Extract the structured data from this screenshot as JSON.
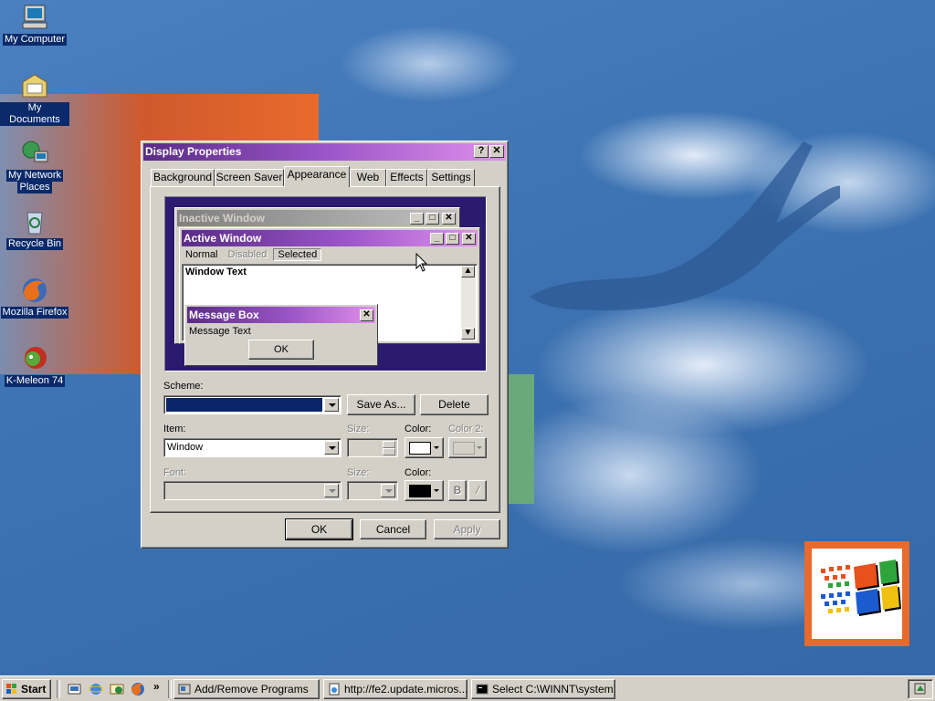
{
  "desktop": {
    "icons": [
      {
        "label": "My Computer",
        "icon": "my-computer-icon"
      },
      {
        "label": "My Documents",
        "icon": "my-documents-icon"
      },
      {
        "label": "My Network",
        "label2": "Places",
        "icon": "network-places-icon"
      },
      {
        "label": "Recycle Bin",
        "icon": "recycle-bin-icon"
      },
      {
        "label": "Mozilla Firefox",
        "icon": "firefox-icon"
      },
      {
        "label": "K-Meleon 74",
        "icon": "k-meleon-icon"
      }
    ]
  },
  "dialog": {
    "title": "Display Properties",
    "help": "?",
    "close": "✕",
    "tabs": [
      "Background",
      "Screen Saver",
      "Appearance",
      "Web",
      "Effects",
      "Settings"
    ],
    "active_tab": "Appearance",
    "preview": {
      "inactive_title": "Inactive Window",
      "active_title": "Active Window",
      "menu_normal": "Normal",
      "menu_disabled": "Disabled",
      "menu_selected": "Selected",
      "window_text": "Window Text",
      "msgbox_title": "Message Box",
      "msgbox_text": "Message Text",
      "msgbox_ok": "OK"
    },
    "scheme_label": "Scheme:",
    "scheme_value": "",
    "save_as": "Save As...",
    "delete": "Delete",
    "item_label": "Item:",
    "item_value": "Window",
    "size_label": "Size:",
    "color_label": "Color:",
    "color2_label": "Color 2:",
    "font_label": "Font:",
    "font_size_label": "Size:",
    "font_color_label": "Color:",
    "bold": "B",
    "italic": "/",
    "ok": "OK",
    "cancel": "Cancel",
    "apply": "Apply",
    "colors": {
      "item_color": "#ffffff",
      "font_color": "#000000",
      "scheme_fill": "#0a246a"
    }
  },
  "taskbar": {
    "start": "Start",
    "chevron": "»",
    "tasks": [
      {
        "label": "Add/Remove Programs",
        "icon": "add-remove-icon"
      },
      {
        "label": "http://fe2.update.micros...",
        "icon": "ie-page-icon"
      },
      {
        "label": "Select C:\\WINNT\\system...",
        "icon": "console-icon"
      }
    ],
    "quick_launch": [
      "show-desktop-icon",
      "ie-icon",
      "outlook-icon",
      "firefox-icon"
    ]
  }
}
